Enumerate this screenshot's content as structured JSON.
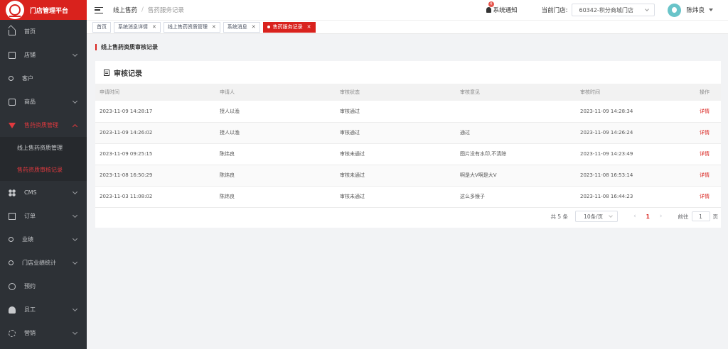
{
  "brand": {
    "title": "门店管理平台"
  },
  "sidebar": {
    "items": [
      {
        "label": "首页"
      },
      {
        "label": "店铺"
      },
      {
        "label": "客户"
      },
      {
        "label": "商品"
      },
      {
        "label": "售药资质管理"
      },
      {
        "label": "CMS"
      },
      {
        "label": "订单"
      },
      {
        "label": "业绩"
      },
      {
        "label": "门店业绩统计"
      },
      {
        "label": "预约"
      },
      {
        "label": "员工"
      },
      {
        "label": "营销"
      }
    ],
    "subitems": [
      {
        "label": "线上售药资质管理"
      },
      {
        "label": "售药资质审核记录"
      }
    ]
  },
  "header": {
    "breadcrumb1": "线上售药",
    "breadcrumb_sep": "/",
    "breadcrumb2": "售药服务记录",
    "notice_badge": "4",
    "notice": "系统通知",
    "store_label": "当前门店:",
    "store_value": "60342-积分商城门店",
    "user_name": "陈炜良"
  },
  "tabs": [
    {
      "label": "首页"
    },
    {
      "label": "系统消息详情",
      "close": "✕"
    },
    {
      "label": "线上售药资质管理",
      "close": "✕"
    },
    {
      "label": "系统消息",
      "close": "✕"
    },
    {
      "label": "售药服务记录",
      "close": "✕"
    }
  ],
  "page": {
    "title": "线上售药资质审核记录",
    "card_title": "审核记录"
  },
  "table": {
    "headers": [
      "申请时间",
      "申请人",
      "审核状态",
      "审核意见",
      "审核时间",
      "操作"
    ],
    "rows": [
      {
        "apply_time": "2023-11-09 14:28:17",
        "applicant": "授人以渔",
        "status": "审核通过",
        "opinion": "",
        "review_time": "2023-11-09 14:28:34",
        "action": "详情"
      },
      {
        "apply_time": "2023-11-09 14:26:02",
        "applicant": "授人以渔",
        "status": "审核通过",
        "opinion": "通过",
        "review_time": "2023-11-09 14:26:24",
        "action": "详情"
      },
      {
        "apply_time": "2023-11-09 09:25:15",
        "applicant": "陈炜良",
        "status": "审核未通过",
        "opinion": "图片没有水印,不清除",
        "review_time": "2023-11-09 14:23:49",
        "action": "详情"
      },
      {
        "apply_time": "2023-11-08 16:50:29",
        "applicant": "陈炜良",
        "status": "审核未通过",
        "opinion": "啊是大V啊是大V",
        "review_time": "2023-11-08 16:53:14",
        "action": "详情"
      },
      {
        "apply_time": "2023-11-03 11:08:02",
        "applicant": "陈炜良",
        "status": "审核未通过",
        "opinion": "这么多猴子",
        "review_time": "2023-11-08 16:44:23",
        "action": "详情"
      }
    ]
  },
  "pager": {
    "total": "共 5 条",
    "page_size": "10条/页",
    "prev": "‹",
    "current": "1",
    "next": "›",
    "goto_label": "前往",
    "goto_value": "1",
    "goto_unit": "页"
  },
  "colors": {
    "accent": "#d9221d",
    "sidebar_bg": "#2d3136"
  }
}
